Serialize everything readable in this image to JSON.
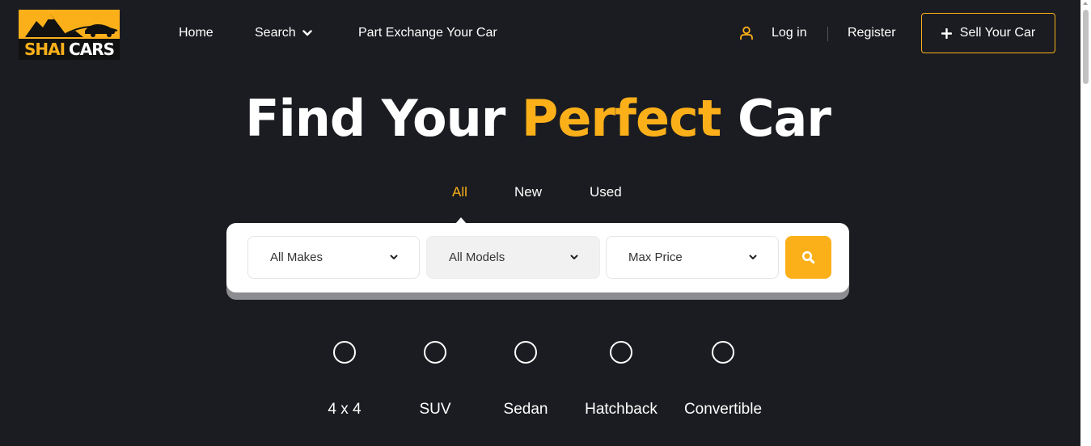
{
  "brand": {
    "logo_word1": "SHAI",
    "logo_word2": "CARS",
    "accent_color": "#fbb01a",
    "background_color": "#1b1c21"
  },
  "nav": {
    "home": "Home",
    "search": "Search",
    "part_exchange": "Part Exchange Your Car",
    "login": "Log in",
    "register": "Register",
    "sell_button": "Sell Your Car",
    "icons": [
      "user-icon",
      "chevron-down-icon",
      "plus-icon"
    ]
  },
  "hero": {
    "title_part1": "Find Your ",
    "title_accent": "Perfect",
    "title_part2": " Car"
  },
  "tabs": [
    {
      "label": "All",
      "active": true
    },
    {
      "label": "New",
      "active": false
    },
    {
      "label": "Used",
      "active": false
    }
  ],
  "search": {
    "makes": "All Makes",
    "models": "All Models",
    "max_price": "Max Price",
    "button_icon": "search-icon"
  },
  "body_types": [
    {
      "label": "4 x 4"
    },
    {
      "label": "SUV"
    },
    {
      "label": "Sedan"
    },
    {
      "label": "Hatchback"
    },
    {
      "label": "Convertible"
    }
  ]
}
